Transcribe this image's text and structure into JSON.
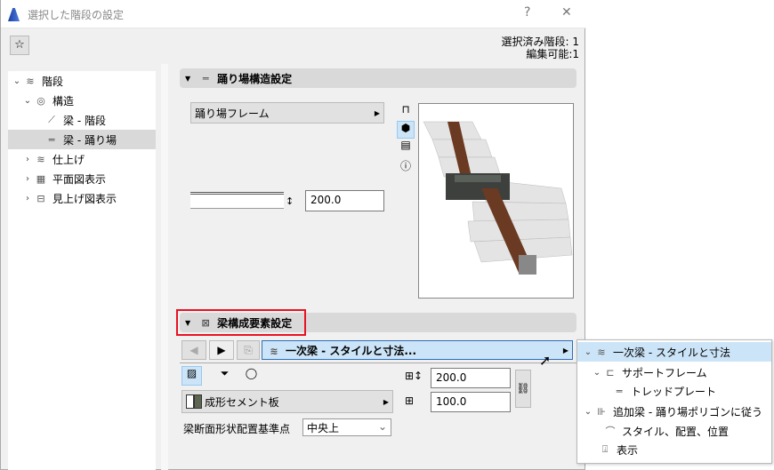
{
  "window": {
    "title": "選択した階段の設定",
    "help": "?",
    "close": "✕"
  },
  "info": {
    "selected": "選択済み階段: 1",
    "editable": "編集可能:1"
  },
  "tree": [
    {
      "label": "階段",
      "expanded": true,
      "level": 0
    },
    {
      "label": "構造",
      "expanded": true,
      "level": 1
    },
    {
      "label": "梁 - 階段",
      "level": 2
    },
    {
      "label": "梁 - 踊り場",
      "level": 2,
      "selected": true
    },
    {
      "label": "仕上げ",
      "level": 1
    },
    {
      "label": "平面図表示",
      "level": 1
    },
    {
      "label": "見上げ図表示",
      "level": 1
    }
  ],
  "section1": {
    "title": "踊り場構造設定",
    "frame_dropdown": "踊り場フレーム",
    "thickness": "200.0"
  },
  "section2": {
    "title": "梁構成要素設定",
    "component_dropdown": "一次梁 - スタイルと寸法...",
    "width": "200.0",
    "height": "100.0",
    "material": "成形セメント板",
    "anchor_label": "梁断面形状配置基準点",
    "anchor_value": "中央上"
  },
  "popup": [
    {
      "label": "一次梁 - スタイルと寸法",
      "chev": "⌄",
      "selected": true
    },
    {
      "label": "サポートフレーム",
      "chev": "⌄"
    },
    {
      "label": "トレッドプレート"
    },
    {
      "label": "追加梁 - 踊り場ポリゴンに従う",
      "chev": "⌄"
    },
    {
      "label": "スタイル、配置、位置"
    },
    {
      "label": "表示"
    }
  ],
  "colors": {
    "accent": "#cce4f7",
    "highlight_border": "#e81123",
    "selected_tree": "#d9d9d9"
  }
}
